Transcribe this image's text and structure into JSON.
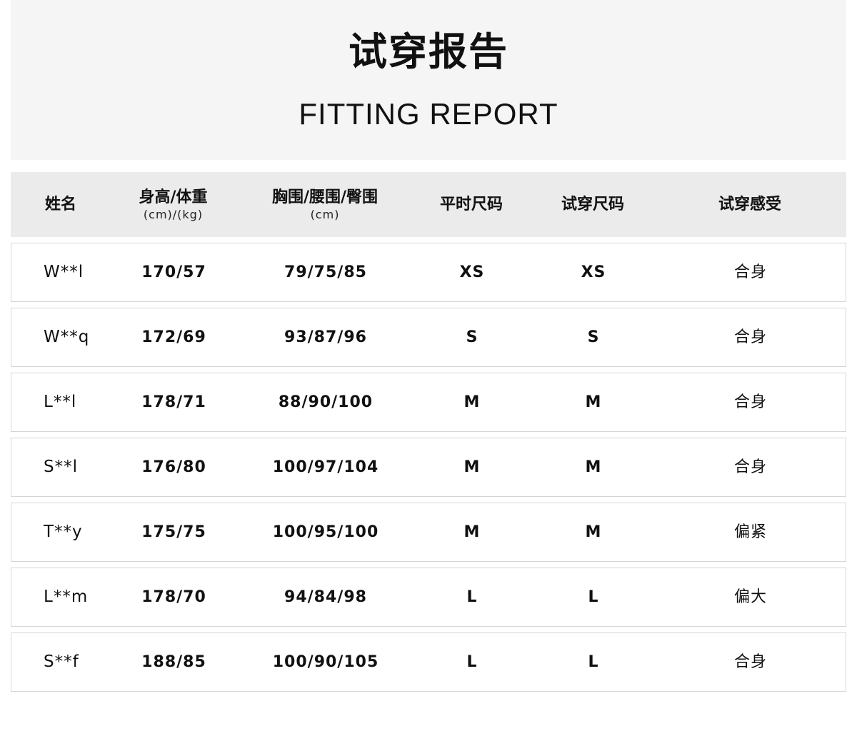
{
  "header": {
    "title_cn": "试穿报告",
    "title_en": "FITTING REPORT"
  },
  "table": {
    "columns": [
      {
        "label": "姓名",
        "sub": ""
      },
      {
        "label": "身高/体重",
        "sub": "(cm)/(kg)"
      },
      {
        "label": "胸围/腰围/臀围",
        "sub": "(cm)"
      },
      {
        "label": "平时尺码",
        "sub": ""
      },
      {
        "label": "试穿尺码",
        "sub": ""
      },
      {
        "label": "试穿感受",
        "sub": ""
      }
    ],
    "rows": [
      {
        "name": "W**l",
        "height_weight": "170/57",
        "measurements": "79/75/85",
        "usual_size": "XS",
        "trial_size": "XS",
        "feeling": "合身"
      },
      {
        "name": "W**q",
        "height_weight": "172/69",
        "measurements": "93/87/96",
        "usual_size": "S",
        "trial_size": "S",
        "feeling": "合身"
      },
      {
        "name": "L**l",
        "height_weight": "178/71",
        "measurements": "88/90/100",
        "usual_size": "M",
        "trial_size": "M",
        "feeling": "合身"
      },
      {
        "name": "S**l",
        "height_weight": "176/80",
        "measurements": "100/97/104",
        "usual_size": "M",
        "trial_size": "M",
        "feeling": "合身"
      },
      {
        "name": "T**y",
        "height_weight": "175/75",
        "measurements": "100/95/100",
        "usual_size": "M",
        "trial_size": "M",
        "feeling": "偏紧"
      },
      {
        "name": "L**m",
        "height_weight": "178/70",
        "measurements": "94/84/98",
        "usual_size": "L",
        "trial_size": "L",
        "feeling": "偏大"
      },
      {
        "name": "S**f",
        "height_weight": "188/85",
        "measurements": "100/90/105",
        "usual_size": "L",
        "trial_size": "L",
        "feeling": "合身"
      }
    ]
  }
}
